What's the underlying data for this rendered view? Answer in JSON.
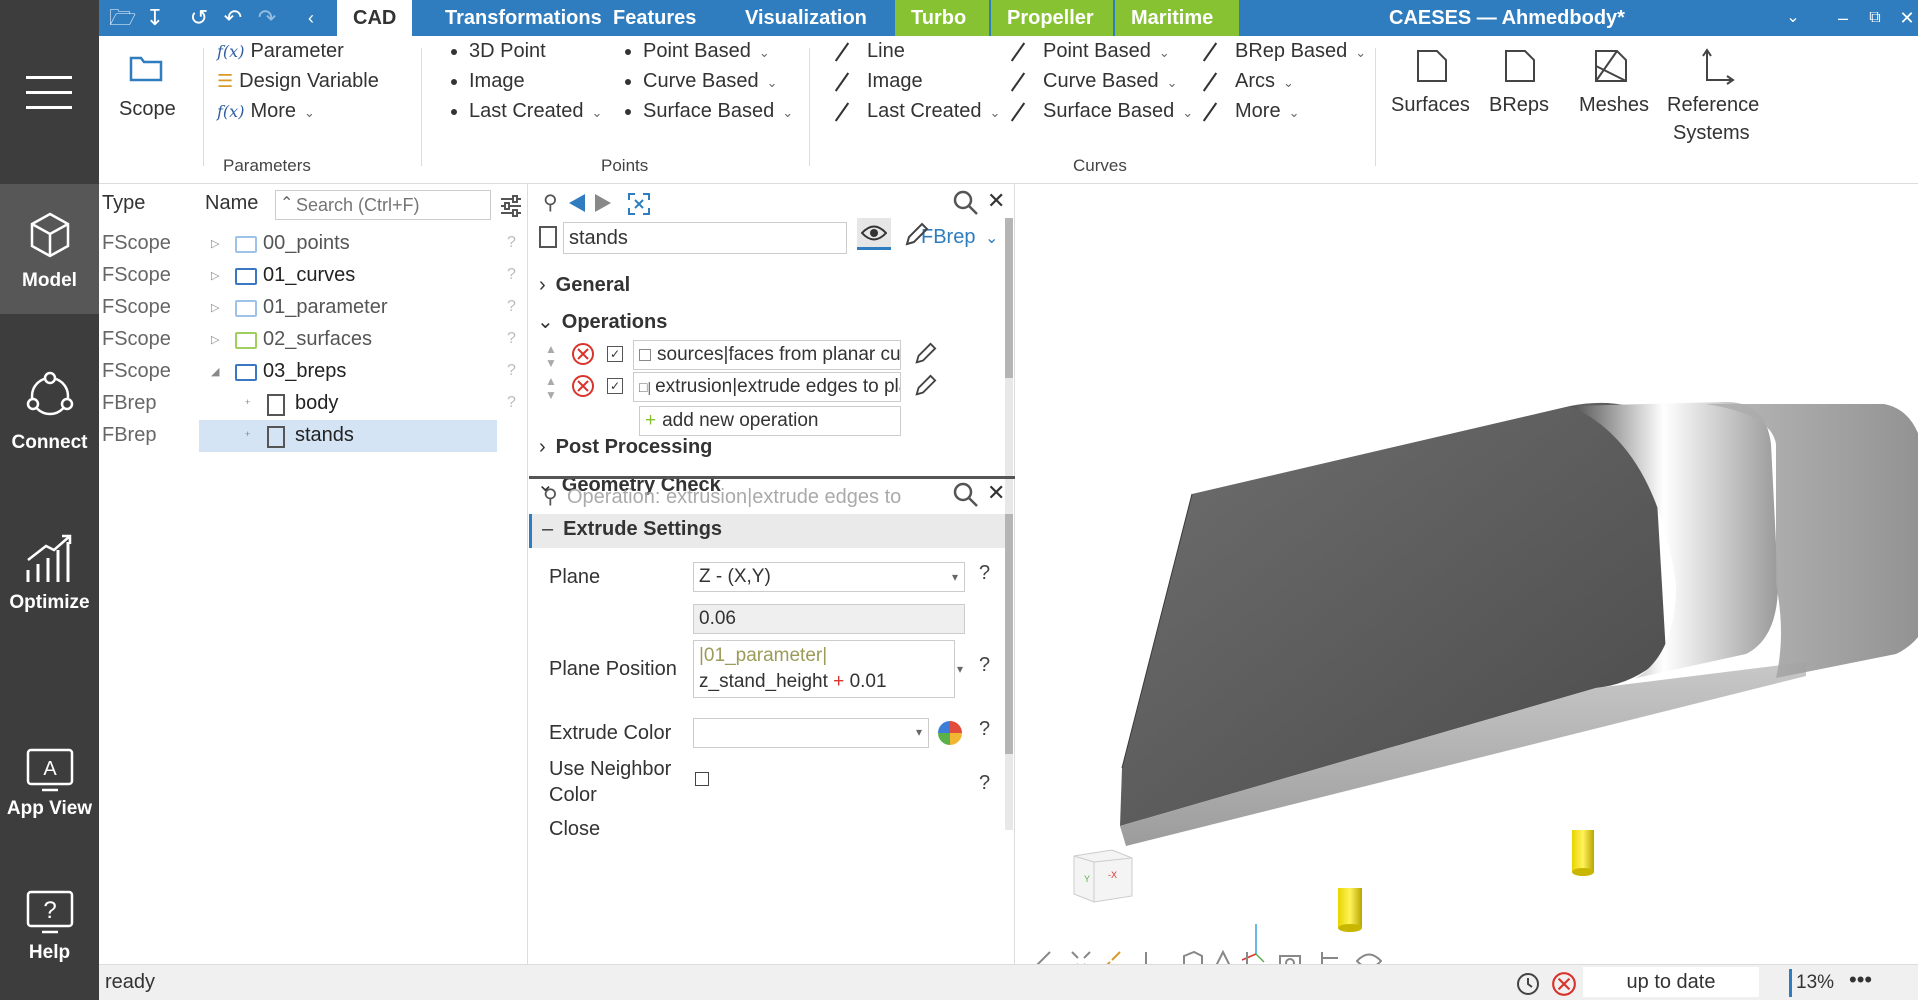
{
  "sidebar": {
    "items": [
      {
        "label": "Model",
        "icon": "cube-icon"
      },
      {
        "label": "Connect",
        "icon": "connect-icon"
      },
      {
        "label": "Optimize",
        "icon": "chart-icon"
      },
      {
        "label": "App View",
        "icon": "app-view-icon"
      },
      {
        "label": "Help",
        "icon": "help-icon"
      }
    ]
  },
  "titlebar": {
    "tabs": [
      "CAD",
      "Transformations",
      "Features",
      "Visualization",
      "Turbo",
      "Propeller",
      "Maritime"
    ],
    "title": "CAESES — Ahmedbody*",
    "accent": "#2f7dbf",
    "green": "#86c232"
  },
  "ribbon": {
    "scope_label": "Scope",
    "parameters": {
      "items": [
        "Parameter",
        "Design Variable",
        "More"
      ],
      "group": "Parameters"
    },
    "points_left": [
      "3D Point",
      "Image",
      "Last Created"
    ],
    "points_right": [
      "Point Based",
      "Curve Based",
      "Surface Based"
    ],
    "points_group": "Points",
    "curves_left": [
      "Line",
      "Image",
      "Last Created"
    ],
    "curves_mid": [
      "Point Based",
      "Curve Based",
      "Surface Based"
    ],
    "curves_right": [
      "BRep Based",
      "Arcs",
      "More"
    ],
    "curves_group": "Curves",
    "big": [
      "Surfaces",
      "BReps",
      "Meshes"
    ],
    "reference": [
      "Reference",
      "Systems"
    ]
  },
  "tree": {
    "col_type": "Type",
    "col_name": "Name",
    "search_placeholder": "Search (Ctrl+F)",
    "rows": [
      {
        "type": "FScope",
        "name": "00_points",
        "q": "?"
      },
      {
        "type": "FScope",
        "name": "01_curves",
        "q": "?"
      },
      {
        "type": "FScope",
        "name": "01_parameter",
        "q": "?"
      },
      {
        "type": "FScope",
        "name": "02_surfaces",
        "q": "?"
      },
      {
        "type": "FScope",
        "name": "03_breps",
        "q": "?"
      },
      {
        "type": "FBrep",
        "name": "body",
        "q": "?"
      },
      {
        "type": "FBrep",
        "name": "stands",
        "q": ""
      }
    ]
  },
  "props": {
    "type_label": "FBrep",
    "object_name": "stands",
    "sections": {
      "general": "General",
      "operations": "Operations",
      "post": "Post Processing",
      "geom": "Geometry Check"
    },
    "operations": [
      "sources|faces from planar curve",
      "extrusion|extrude edges to plan"
    ],
    "add_operation": "add new operation",
    "op_header": "Operation: extrusion|extrude edges to",
    "extrude_settings": "Extrude Settings",
    "plane_label": "Plane",
    "plane_value": "Z - (X,Y)",
    "plane_pos_label": "Plane Position",
    "plane_pos_value": "0.06",
    "plane_expr_ref": "|01_parameter|",
    "plane_expr_var": "z_stand_height",
    "plane_expr_op": "+",
    "plane_expr_num": "0.01",
    "extrude_color_label": "Extrude Color",
    "neighbor_label_1": "Use Neighbor",
    "neighbor_label_2": "Color",
    "close_label": "Close",
    "q": "?"
  },
  "status": {
    "left": "ready",
    "state": "up to date",
    "zoom": "13%"
  }
}
